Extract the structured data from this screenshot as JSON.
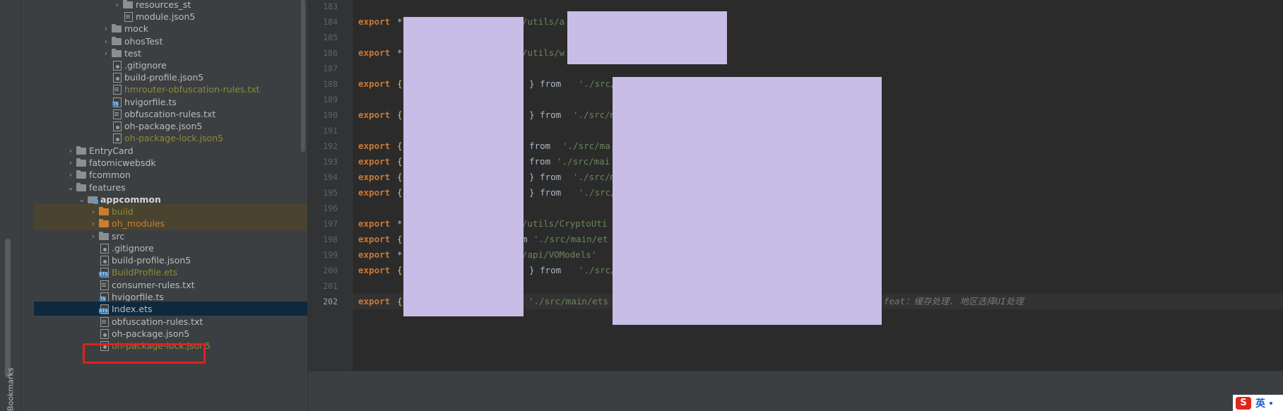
{
  "sidebar": {
    "bookmarks_label": "Bookmarks"
  },
  "project_tree": {
    "items": [
      {
        "label": "resources_st",
        "type": "folder",
        "expanded": false
      },
      {
        "label": "module.json5",
        "type": "file"
      },
      {
        "label": "mock",
        "type": "folder",
        "expanded": false
      },
      {
        "label": "ohosTest",
        "type": "folder",
        "expanded": false
      },
      {
        "label": "test",
        "type": "folder",
        "expanded": false
      },
      {
        "label": ".gitignore",
        "type": "file"
      },
      {
        "label": "build-profile.json5",
        "type": "file"
      },
      {
        "label": "hmrouter-obfuscation-rules.txt",
        "type": "file"
      },
      {
        "label": "hvigorfile.ts",
        "type": "ts"
      },
      {
        "label": "obfuscation-rules.txt",
        "type": "file"
      },
      {
        "label": "oh-package.json5",
        "type": "file"
      },
      {
        "label": "oh-package-lock.json5",
        "type": "file"
      },
      {
        "label": "EntryCard",
        "type": "folder",
        "expanded": false
      },
      {
        "label": "fatomicwebsdk",
        "type": "folder",
        "expanded": false
      },
      {
        "label": "fcommon",
        "type": "folder",
        "expanded": false
      },
      {
        "label": "features",
        "type": "folder",
        "expanded": true
      },
      {
        "label": "appcommon",
        "type": "module",
        "expanded": true
      },
      {
        "label": "build",
        "type": "folder",
        "expanded": false
      },
      {
        "label": "oh_modules",
        "type": "folder",
        "expanded": false
      },
      {
        "label": "src",
        "type": "folder",
        "expanded": false
      },
      {
        "label": ".gitignore",
        "type": "file"
      },
      {
        "label": "build-profile.json5",
        "type": "file"
      },
      {
        "label": "BuildProfile.ets",
        "type": "ets"
      },
      {
        "label": "consumer-rules.txt",
        "type": "file"
      },
      {
        "label": "hvigorfile.ts",
        "type": "ts"
      },
      {
        "label": "Index.ets",
        "type": "ets",
        "selected": true
      },
      {
        "label": "obfuscation-rules.txt",
        "type": "file"
      },
      {
        "label": "oh-package.json5",
        "type": "file"
      },
      {
        "label": "oh-package-lock.json5",
        "type": "file"
      }
    ]
  },
  "editor": {
    "line_numbers": [
      "183",
      "184",
      "185",
      "186",
      "187",
      "188",
      "189",
      "190",
      "191",
      "192",
      "193",
      "194",
      "195",
      "196",
      "197",
      "198",
      "199",
      "200",
      "201",
      "202"
    ],
    "current_line": "202",
    "lines": [
      {
        "n": "183"
      },
      {
        "n": "184",
        "kw": "export",
        "p1": "*",
        "str": "/utils/a"
      },
      {
        "n": "185"
      },
      {
        "n": "186",
        "kw": "export",
        "p1": "*",
        "str": "/utils/w"
      },
      {
        "n": "187"
      },
      {
        "n": "188",
        "kw": "export",
        "br": "{",
        "mid": "r } from",
        "str": "'./src/"
      },
      {
        "n": "189"
      },
      {
        "n": "190",
        "kw": "export",
        "br": "{",
        "mid": "} from",
        "str": "'./src/m"
      },
      {
        "n": "191"
      },
      {
        "n": "192",
        "kw": "export",
        "br": "{",
        "mid": "} from",
        "str": "'./src/ma"
      },
      {
        "n": "193",
        "kw": "export",
        "br": "{",
        "mid": "from",
        "str": "'./src/mai"
      },
      {
        "n": "194",
        "kw": "export",
        "br": "{",
        "mid": "} from",
        "str": "'./src/m"
      },
      {
        "n": "195",
        "kw": "export",
        "br": "{",
        "mid": "r } from",
        "str": "'./src/"
      },
      {
        "n": "196"
      },
      {
        "n": "197",
        "kw": "export",
        "p1": "*",
        "str": "/utils/CryptoUti"
      },
      {
        "n": "198",
        "kw": "export",
        "br": "{",
        "mid": "m",
        "str": "'./src/main/et"
      },
      {
        "n": "199",
        "kw": "export",
        "p1": "*",
        "str": "/api/VOModels'"
      },
      {
        "n": "200",
        "kw": "export",
        "br": "{",
        "mid": "r } from",
        "str": "'./src/"
      },
      {
        "n": "201"
      },
      {
        "n": "202",
        "kw": "export",
        "br": "{",
        "str": "'./src/main/ets",
        "annotation": "feat：缓存处理. 地区选择UI处理"
      }
    ]
  },
  "ime": {
    "logo": "S",
    "mode": "英"
  },
  "colors": {
    "panel": "#3c3f41",
    "editor_bg": "#2b2b2b",
    "keyword": "#cc7832",
    "string": "#6a8759",
    "redaction": "#c7bde6",
    "highlight_box": "#e02020"
  }
}
